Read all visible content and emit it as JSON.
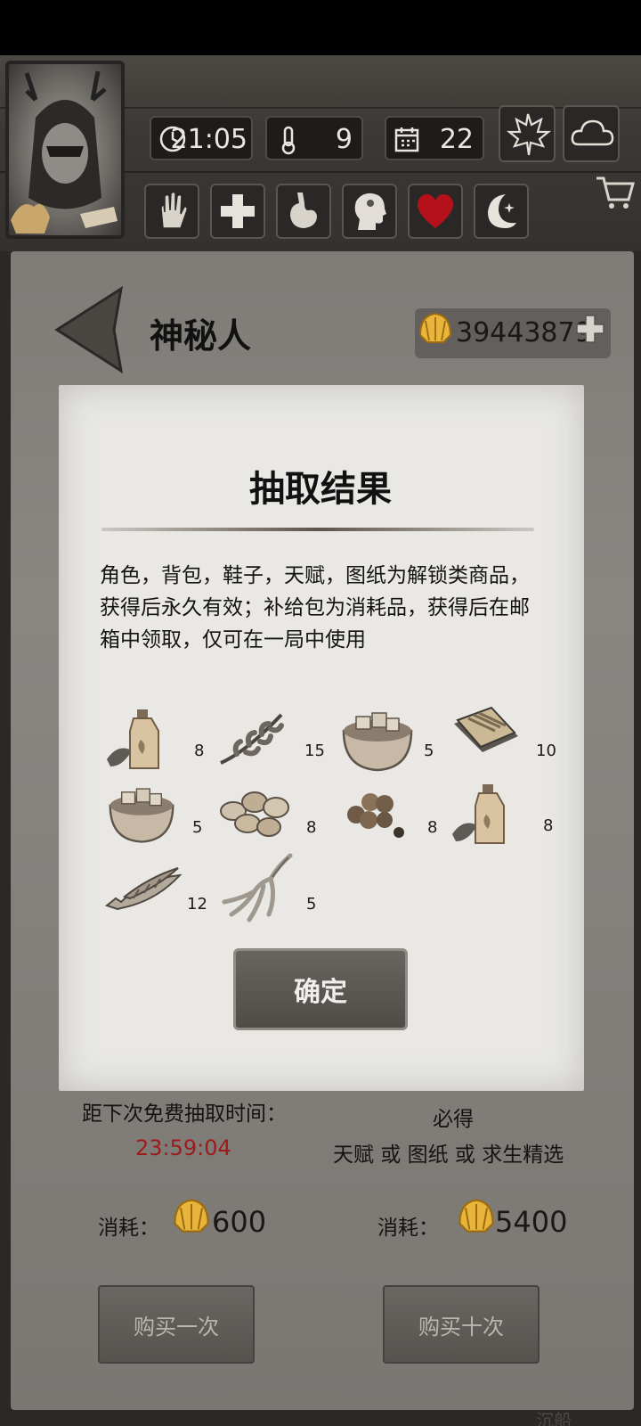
{
  "hud": {
    "time": "21:05",
    "temperature": "9",
    "day": "22",
    "status_icons": [
      "hand-icon",
      "health-cross-icon",
      "stomach-icon",
      "head-icon",
      "heart-icon",
      "moon-icon"
    ],
    "season_icon": "maple-leaf-icon",
    "weather_icon": "cloud-icon"
  },
  "shop": {
    "title": "神秘人",
    "currency": "39443879"
  },
  "dialog": {
    "title": "抽取结果",
    "description": "角色，背包，鞋子，天赋，图纸为解锁类商品，获得后永久有效；补给包为消耗品，获得后在邮箱中领取，仅可在一局中使用",
    "items": [
      {
        "icon": "bottle-herb-icon",
        "qty": "8"
      },
      {
        "icon": "herb-branch-icon",
        "qty": "15"
      },
      {
        "icon": "bowl-icon",
        "qty": "5"
      },
      {
        "icon": "fish-tray-icon",
        "qty": "10"
      },
      {
        "icon": "bowl-icon",
        "qty": "5"
      },
      {
        "icon": "nuts-icon",
        "qty": "8"
      },
      {
        "icon": "berries-icon",
        "qty": "8"
      },
      {
        "icon": "bottle-herb-icon",
        "qty": "8"
      },
      {
        "icon": "dried-fish-icon",
        "qty": "12"
      },
      {
        "icon": "ginseng-icon",
        "qty": "5"
      }
    ],
    "confirm_label": "确定"
  },
  "draw": {
    "free_label": "距下次免费抽取时间：",
    "timer": "23:59:04",
    "guarantee": "必得",
    "guarantee_detail": "天赋 或 图纸 或 求生精选",
    "cost_label": "消耗：",
    "single_cost": "600",
    "ten_cost": "5400",
    "buy_once": "购买一次",
    "buy_ten": "购买十次",
    "bottom_hint": "沉船"
  },
  "colors": {
    "timer": "#9c1b1b",
    "heart": "#b3121a",
    "shell": "#e8b43a"
  }
}
